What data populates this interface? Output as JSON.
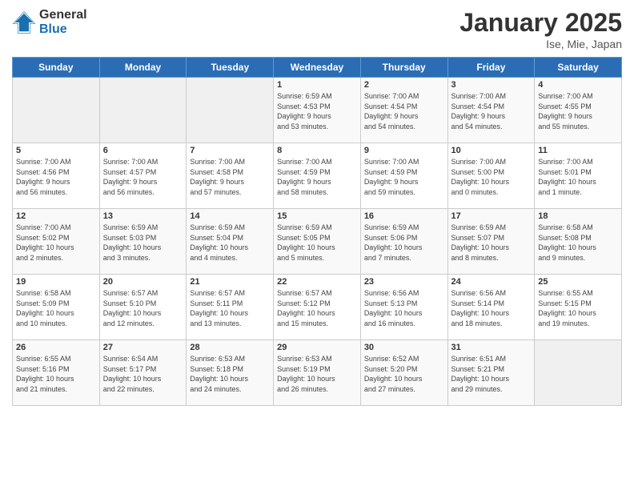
{
  "logo": {
    "general": "General",
    "blue": "Blue"
  },
  "title": "January 2025",
  "subtitle": "Ise, Mie, Japan",
  "days_of_week": [
    "Sunday",
    "Monday",
    "Tuesday",
    "Wednesday",
    "Thursday",
    "Friday",
    "Saturday"
  ],
  "weeks": [
    [
      {
        "day": "",
        "info": ""
      },
      {
        "day": "",
        "info": ""
      },
      {
        "day": "",
        "info": ""
      },
      {
        "day": "1",
        "info": "Sunrise: 6:59 AM\nSunset: 4:53 PM\nDaylight: 9 hours\nand 53 minutes."
      },
      {
        "day": "2",
        "info": "Sunrise: 7:00 AM\nSunset: 4:54 PM\nDaylight: 9 hours\nand 54 minutes."
      },
      {
        "day": "3",
        "info": "Sunrise: 7:00 AM\nSunset: 4:54 PM\nDaylight: 9 hours\nand 54 minutes."
      },
      {
        "day": "4",
        "info": "Sunrise: 7:00 AM\nSunset: 4:55 PM\nDaylight: 9 hours\nand 55 minutes."
      }
    ],
    [
      {
        "day": "5",
        "info": "Sunrise: 7:00 AM\nSunset: 4:56 PM\nDaylight: 9 hours\nand 56 minutes."
      },
      {
        "day": "6",
        "info": "Sunrise: 7:00 AM\nSunset: 4:57 PM\nDaylight: 9 hours\nand 56 minutes."
      },
      {
        "day": "7",
        "info": "Sunrise: 7:00 AM\nSunset: 4:58 PM\nDaylight: 9 hours\nand 57 minutes."
      },
      {
        "day": "8",
        "info": "Sunrise: 7:00 AM\nSunset: 4:59 PM\nDaylight: 9 hours\nand 58 minutes."
      },
      {
        "day": "9",
        "info": "Sunrise: 7:00 AM\nSunset: 4:59 PM\nDaylight: 9 hours\nand 59 minutes."
      },
      {
        "day": "10",
        "info": "Sunrise: 7:00 AM\nSunset: 5:00 PM\nDaylight: 10 hours\nand 0 minutes."
      },
      {
        "day": "11",
        "info": "Sunrise: 7:00 AM\nSunset: 5:01 PM\nDaylight: 10 hours\nand 1 minute."
      }
    ],
    [
      {
        "day": "12",
        "info": "Sunrise: 7:00 AM\nSunset: 5:02 PM\nDaylight: 10 hours\nand 2 minutes."
      },
      {
        "day": "13",
        "info": "Sunrise: 6:59 AM\nSunset: 5:03 PM\nDaylight: 10 hours\nand 3 minutes."
      },
      {
        "day": "14",
        "info": "Sunrise: 6:59 AM\nSunset: 5:04 PM\nDaylight: 10 hours\nand 4 minutes."
      },
      {
        "day": "15",
        "info": "Sunrise: 6:59 AM\nSunset: 5:05 PM\nDaylight: 10 hours\nand 5 minutes."
      },
      {
        "day": "16",
        "info": "Sunrise: 6:59 AM\nSunset: 5:06 PM\nDaylight: 10 hours\nand 7 minutes."
      },
      {
        "day": "17",
        "info": "Sunrise: 6:59 AM\nSunset: 5:07 PM\nDaylight: 10 hours\nand 8 minutes."
      },
      {
        "day": "18",
        "info": "Sunrise: 6:58 AM\nSunset: 5:08 PM\nDaylight: 10 hours\nand 9 minutes."
      }
    ],
    [
      {
        "day": "19",
        "info": "Sunrise: 6:58 AM\nSunset: 5:09 PM\nDaylight: 10 hours\nand 10 minutes."
      },
      {
        "day": "20",
        "info": "Sunrise: 6:57 AM\nSunset: 5:10 PM\nDaylight: 10 hours\nand 12 minutes."
      },
      {
        "day": "21",
        "info": "Sunrise: 6:57 AM\nSunset: 5:11 PM\nDaylight: 10 hours\nand 13 minutes."
      },
      {
        "day": "22",
        "info": "Sunrise: 6:57 AM\nSunset: 5:12 PM\nDaylight: 10 hours\nand 15 minutes."
      },
      {
        "day": "23",
        "info": "Sunrise: 6:56 AM\nSunset: 5:13 PM\nDaylight: 10 hours\nand 16 minutes."
      },
      {
        "day": "24",
        "info": "Sunrise: 6:56 AM\nSunset: 5:14 PM\nDaylight: 10 hours\nand 18 minutes."
      },
      {
        "day": "25",
        "info": "Sunrise: 6:55 AM\nSunset: 5:15 PM\nDaylight: 10 hours\nand 19 minutes."
      }
    ],
    [
      {
        "day": "26",
        "info": "Sunrise: 6:55 AM\nSunset: 5:16 PM\nDaylight: 10 hours\nand 21 minutes."
      },
      {
        "day": "27",
        "info": "Sunrise: 6:54 AM\nSunset: 5:17 PM\nDaylight: 10 hours\nand 22 minutes."
      },
      {
        "day": "28",
        "info": "Sunrise: 6:53 AM\nSunset: 5:18 PM\nDaylight: 10 hours\nand 24 minutes."
      },
      {
        "day": "29",
        "info": "Sunrise: 6:53 AM\nSunset: 5:19 PM\nDaylight: 10 hours\nand 26 minutes."
      },
      {
        "day": "30",
        "info": "Sunrise: 6:52 AM\nSunset: 5:20 PM\nDaylight: 10 hours\nand 27 minutes."
      },
      {
        "day": "31",
        "info": "Sunrise: 6:51 AM\nSunset: 5:21 PM\nDaylight: 10 hours\nand 29 minutes."
      },
      {
        "day": "",
        "info": ""
      }
    ]
  ]
}
